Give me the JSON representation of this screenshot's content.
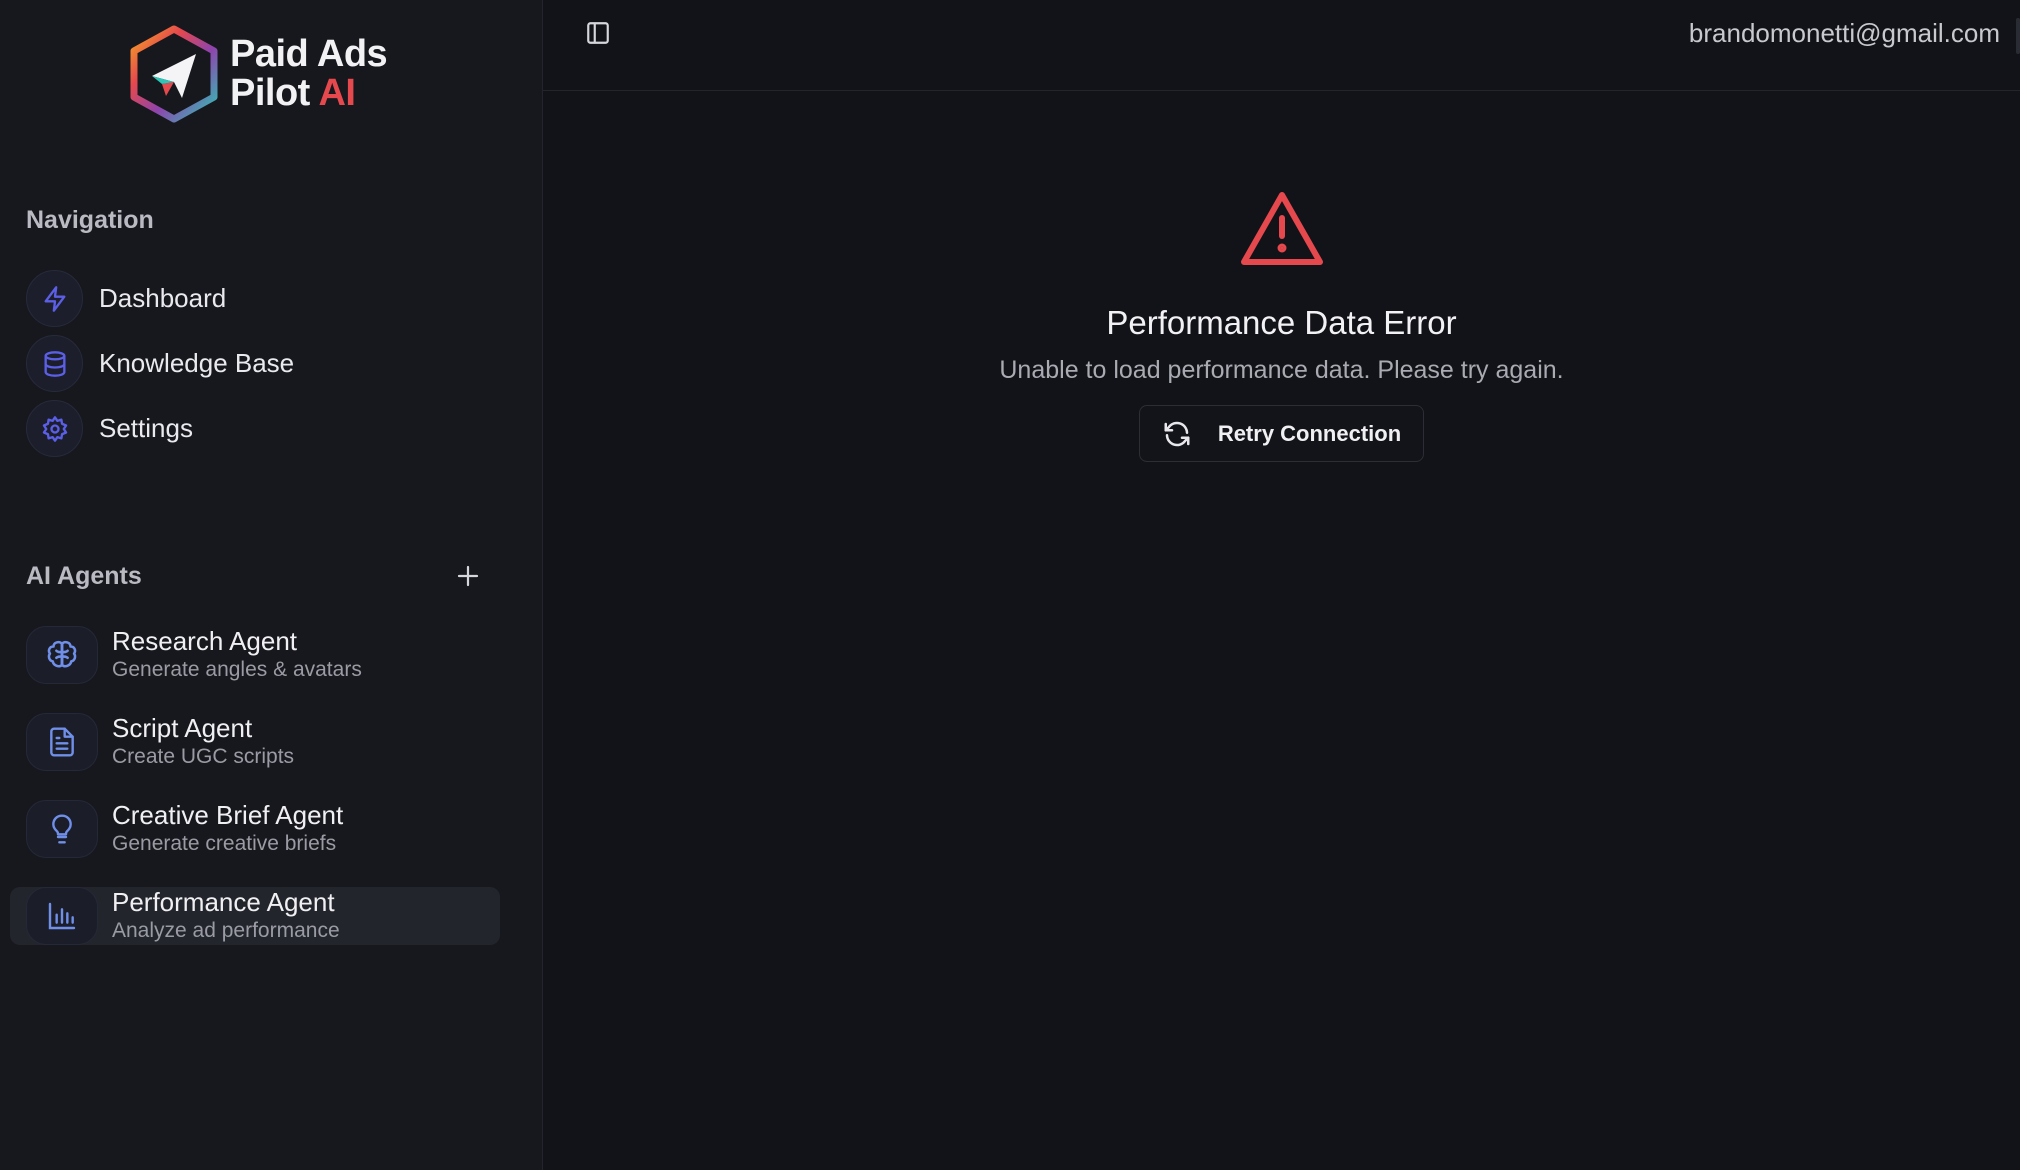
{
  "brand": {
    "line1": "Paid Ads",
    "line2_prefix": "Pilot ",
    "line2_accent": "AI",
    "accent_color": "#e5484d"
  },
  "sidebar": {
    "navigation_label": "Navigation",
    "nav_items": [
      {
        "label": "Dashboard",
        "icon": "lightning-icon"
      },
      {
        "label": "Knowledge Base",
        "icon": "database-icon"
      },
      {
        "label": "Settings",
        "icon": "gear-icon"
      }
    ],
    "agents_label": "AI Agents",
    "agents": [
      {
        "name": "Research Agent",
        "description": "Generate angles & avatars",
        "icon": "brain-icon"
      },
      {
        "name": "Script Agent",
        "description": "Create UGC scripts",
        "icon": "document-icon"
      },
      {
        "name": "Creative Brief Agent",
        "description": "Generate creative briefs",
        "icon": "lightbulb-icon"
      },
      {
        "name": "Performance Agent",
        "description": "Analyze ad performance",
        "icon": "bar-chart-icon",
        "active": true
      }
    ]
  },
  "header": {
    "user_email": "brandomonetti@gmail.com"
  },
  "error": {
    "title": "Performance Data Error",
    "message": "Unable to load performance data. Please try again.",
    "retry_label": "Retry Connection",
    "icon": "warning-triangle-icon",
    "color": "#e5484d"
  }
}
